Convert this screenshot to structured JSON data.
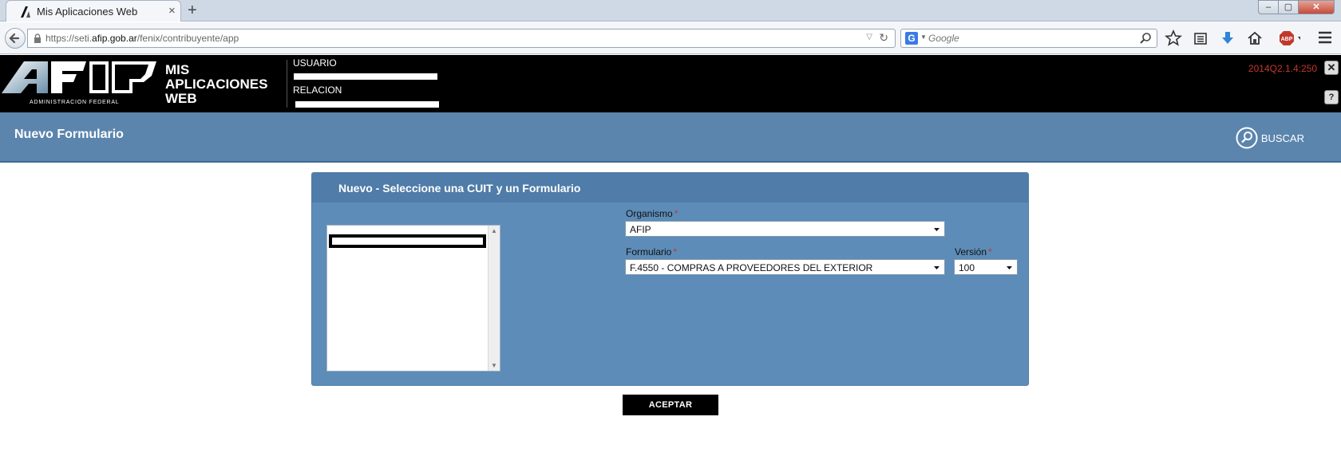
{
  "browser": {
    "tab_title": "Mis Aplicaciones Web",
    "new_tab_glyph": "+",
    "tab_close_glyph": "×",
    "url_prefix": "https://seti.",
    "url_domain": "afip.gob.ar",
    "url_path": "/fenix/contribuyente/app",
    "search_placeholder": "Google",
    "search_engine": "G",
    "win_min": "‒",
    "win_max": "▢",
    "win_close": "✕"
  },
  "header": {
    "logo_subtext": "ADMINISTRACION FEDERAL",
    "app_title_line1": "MIS",
    "app_title_line2": "APLICACIONES",
    "app_title_line3": "WEB",
    "usuario_label": "USUARIO",
    "relacion_label": "RELACION",
    "version": "2014Q2.1.4:250",
    "close_glyph": "✕",
    "help_glyph": "?"
  },
  "titlebar": {
    "title": "Nuevo Formulario",
    "buscar_label": "BUSCAR"
  },
  "panel": {
    "title": "Nuevo - Seleccione una CUIT y un Formulario",
    "organismo_label": "Organismo",
    "organismo_value": "AFIP",
    "formulario_label": "Formulario",
    "formulario_value": "F.4550 - COMPRAS A PROVEEDORES DEL EXTERIOR",
    "version_label": "Versión",
    "version_value": "100",
    "required_mark": "*"
  },
  "actions": {
    "aceptar_label": "ACEPTAR"
  },
  "colors": {
    "header_bg": "#000000",
    "titlebar_bg": "#5b85ad",
    "panel_bg": "#5d8cb8",
    "version_red": "#c0392b"
  }
}
